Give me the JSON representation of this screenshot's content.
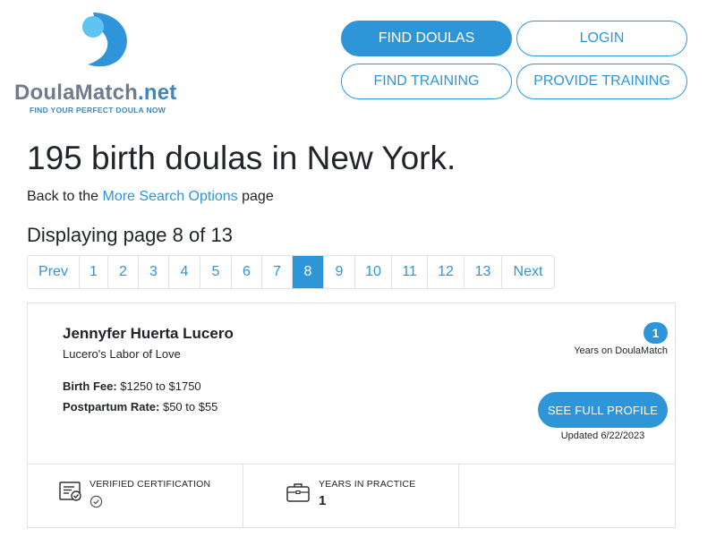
{
  "logo": {
    "name_main": "DoulaMatch",
    "name_suffix": ".net",
    "tagline": "FIND YOUR PERFECT DOULA NOW"
  },
  "nav": {
    "find_doulas": "FIND DOULAS",
    "login": "LOGIN",
    "find_training": "FIND TRAINING",
    "provide_training": "PROVIDE TRAINING"
  },
  "heading": {
    "title": "195 birth doulas in New York.",
    "back_prefix": "Back to the ",
    "back_link": "More Search Options",
    "back_suffix": " page",
    "page_indicator": "Displaying page 8 of 13"
  },
  "pagination": {
    "prev": "Prev",
    "pages": [
      "1",
      "2",
      "3",
      "4",
      "5",
      "6",
      "7",
      "8",
      "9",
      "10",
      "11",
      "12",
      "13"
    ],
    "active": "8",
    "next": "Next"
  },
  "listing": {
    "name": "Jennyfer Huerta Lucero",
    "business": "Lucero's Labor of Love",
    "birth_fee_label": "Birth Fee:",
    "birth_fee_value": " $1250 to $1750",
    "postpartum_label": "Postpartum Rate:",
    "postpartum_value": " $50 to $55",
    "years_badge": "1",
    "years_label": "Years on DoulaMatch",
    "profile_button": "SEE FULL PROFILE",
    "updated": "Updated 6/22/2023",
    "certification_label": "VERIFIED CERTIFICATION",
    "practice_label": "YEARS IN PRACTICE",
    "practice_value": "1"
  },
  "colors": {
    "accent": "#2e95d9",
    "logo_gray": "#6d7d8e",
    "border": "#dee2e6"
  }
}
